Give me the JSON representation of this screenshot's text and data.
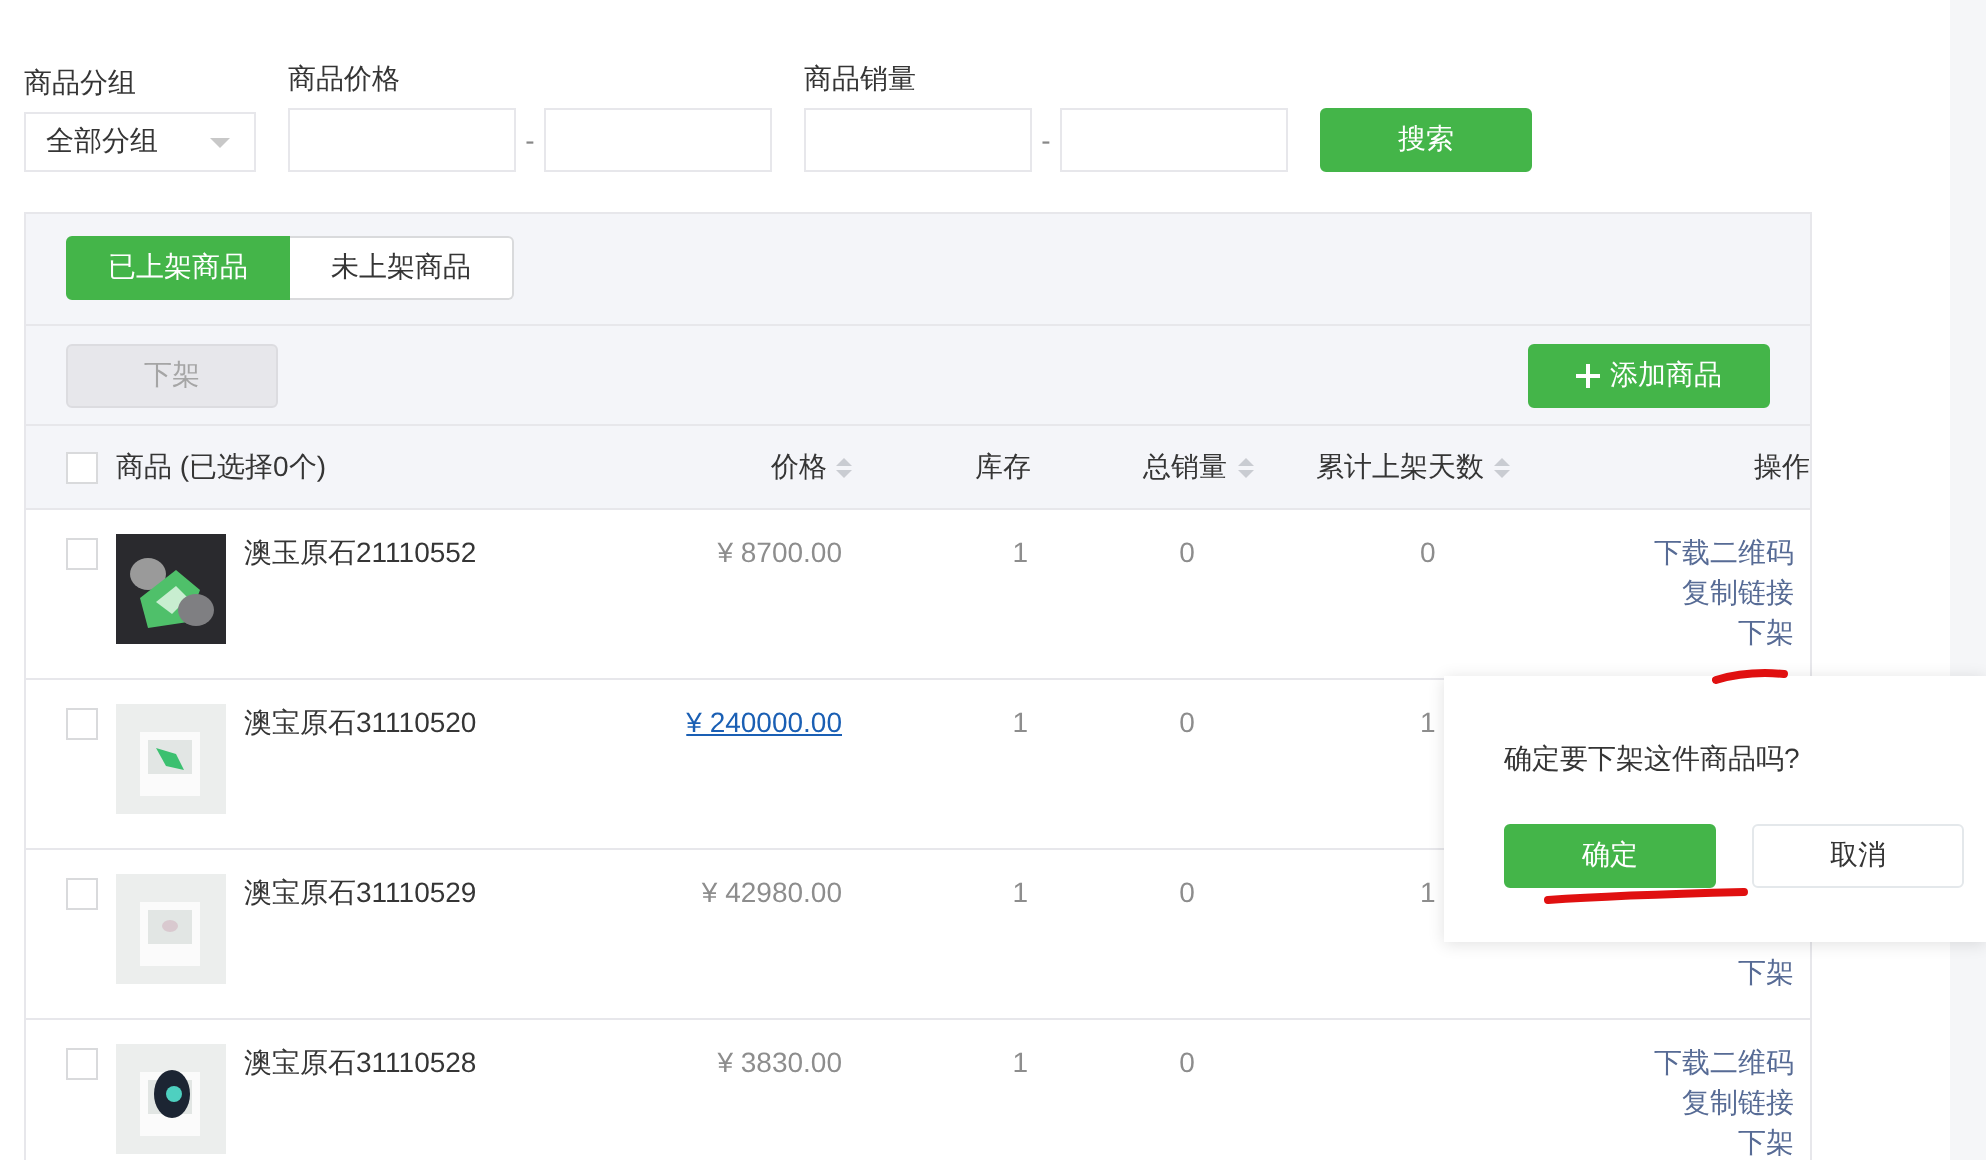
{
  "filters": {
    "group": {
      "label": "商品分组",
      "value": "全部分组"
    },
    "price": {
      "label": "商品价格",
      "separator": "-"
    },
    "sales": {
      "label": "商品销量",
      "separator": "-"
    },
    "search_button": "搜索"
  },
  "tabs": [
    {
      "label": "已上架商品",
      "selected": true
    },
    {
      "label": "未上架商品",
      "selected": false
    }
  ],
  "toolbar": {
    "bulk_button": {
      "label": "下架",
      "disabled": true
    },
    "add_button": "添加商品"
  },
  "table": {
    "columns": [
      {
        "label": "商品 (已选择0个)",
        "sortable": false
      },
      {
        "label": "价格",
        "sortable": true
      },
      {
        "label": "库存",
        "sortable": false
      },
      {
        "label": "总销量",
        "sortable": true
      },
      {
        "label": "累计上架天数",
        "sortable": true
      },
      {
        "label": "操作",
        "sortable": false
      }
    ],
    "header_checked": false,
    "rows": [
      {
        "checked": false,
        "name": "澳玉原石21110552",
        "price": "¥ 8700.00",
        "price_hover": false,
        "stock": "1",
        "sales": "0",
        "days": "0",
        "actions": [
          "下载二维码",
          "复制链接",
          "下架"
        ]
      },
      {
        "checked": false,
        "name": "澳宝原石31110520",
        "price": "¥ 240000.00",
        "price_hover": true,
        "stock": "1",
        "sales": "0",
        "days": "1"
      },
      {
        "checked": false,
        "name": "澳宝原石31110529",
        "price": "¥ 42980.00",
        "price_hover": false,
        "stock": "1",
        "sales": "0",
        "days": "1",
        "actions": [
          "下架"
        ]
      },
      {
        "checked": false,
        "name": "澳宝原石31110528",
        "price": "¥ 3830.00",
        "price_hover": false,
        "stock": "1",
        "sales": "0",
        "actions": [
          "下载二维码",
          "复制链接",
          "下架"
        ]
      }
    ]
  },
  "popover": {
    "message": "确定要下架这件商品吗?",
    "confirm": "确定",
    "cancel": "取消"
  }
}
